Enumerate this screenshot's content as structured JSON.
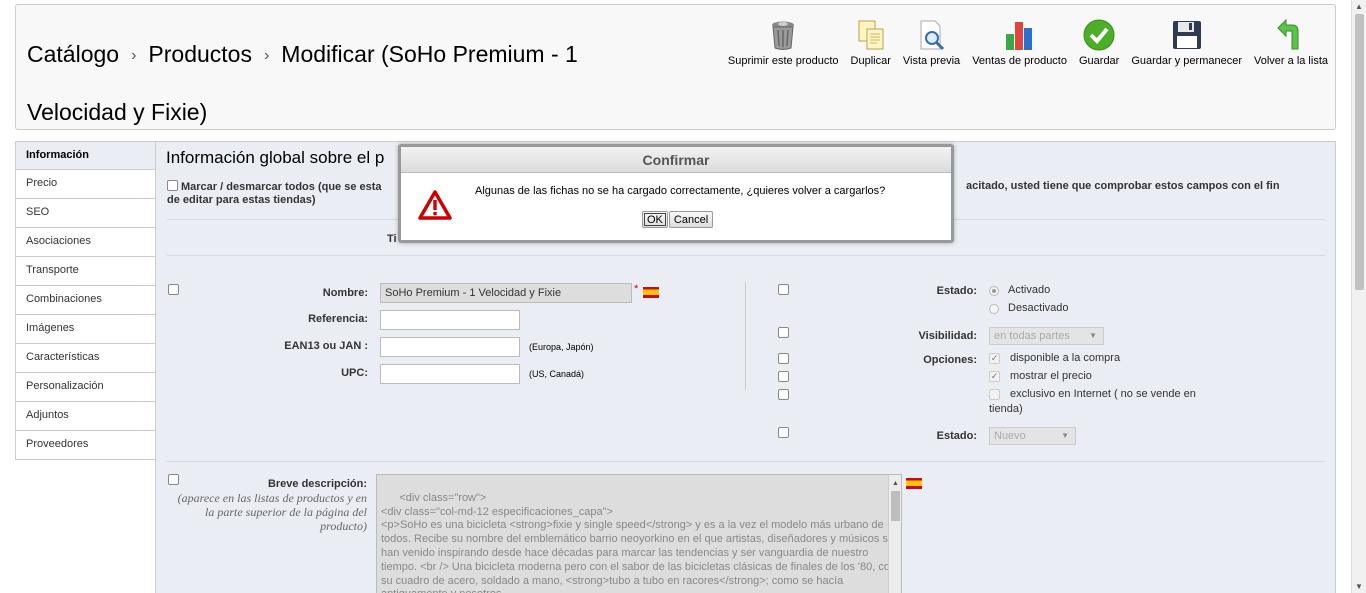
{
  "breadcrumb": {
    "catalog": "Catálogo",
    "sep": "›",
    "products": "Productos",
    "page": "Modificar (SoHo Premium - 1 Velocidad y Fixie)"
  },
  "toolbar": {
    "delete": "Suprimir este producto",
    "duplicate": "Duplicar",
    "preview": "Vista previa",
    "sales": "Ventas de producto",
    "save": "Guardar",
    "save_stay": "Guardar y permanecer",
    "back": "Volver a la lista"
  },
  "tabs": [
    "Información",
    "Precio",
    "SEO",
    "Asociaciones",
    "Transporte",
    "Combinaciones",
    "Imágenes",
    "Características",
    "Personalización",
    "Adjuntos",
    "Proveedores"
  ],
  "panel": {
    "title": "Información global sobre el p",
    "toggle_all": "Marcar / desmarcar todos (que se esta",
    "toggle_all_tail": "acitado, usted tiene que comprobar estos campos con el fin",
    "toggle_all_line2": "de editar para estas tiendas)",
    "ti": "Ti"
  },
  "fields": {
    "name_label": "Nombre:",
    "name_value": "SoHo Premium - 1 Velocidad y Fixie",
    "required": "*",
    "ref_label": "Referencia:",
    "ref_value": "",
    "ean_label": "EAN13 ou JAN :",
    "ean_hint": "(Europa, Japón)",
    "upc_label": "UPC:",
    "upc_hint": "(US, Canadá)"
  },
  "status": {
    "label": "Estado:",
    "on": "Activado",
    "off": "Desactivado",
    "visibility_label": "Visibilidad:",
    "visibility_value": "en todas partes",
    "options_label": "Opciones:",
    "opt_buy": "disponible a la compra",
    "opt_price": "mostrar el precio",
    "opt_online": "exclusivo en Internet ( no se vende en",
    "opt_online2": "tienda)",
    "condition_label": "Estado:",
    "condition_value": "Nuevo"
  },
  "short_desc": {
    "label": "Breve descripción:",
    "hint": "(aparece en las listas de productos y en la parte superior de la página del producto)",
    "content": "<div class=\"row\">\n<div class=\"col-md-12 especificaciones_capa\">\n<p>SoHo es una bicicleta <strong>fixie y single speed</strong> y es a la vez el modelo más urbano de todos. Recibe su nombre del emblemático barrio neoyorkino en el que artistas, diseñadores y músicos se han venido inspirando desde hace décadas para marcar las tendencias y ser vanguardia de nuestro tiempo. <br /> Una bicicleta moderna pero con el sabor de las bicicletas clásicas de finales de los '80, con su cuadro de acero, soldado a mano, <strong>tubo a tubo en racores</strong>; como se hacía antiguamente y nosotros"
  },
  "modal": {
    "title": "Confirmar",
    "message": "Algunas de las fichas no se ha cargado correctamente, ¿quieres volver a cargarlos?",
    "ok": "OK",
    "cancel": "Cancel"
  },
  "colors": {
    "panel_bg": "#ebedf4",
    "save_green": "#4caf27",
    "warn_red": "#cc0000"
  }
}
